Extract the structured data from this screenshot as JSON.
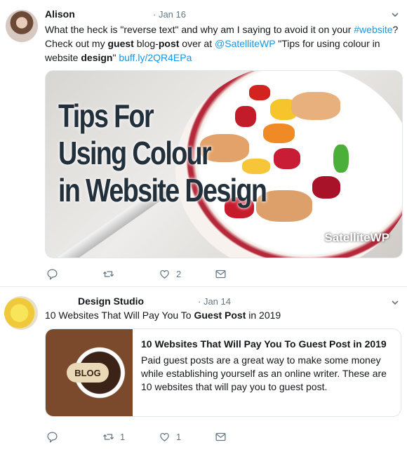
{
  "tweets": [
    {
      "author": "Alison",
      "date": "· Jan 16",
      "text_parts": {
        "p1": "What the heck is \"reverse text\" and why am I saying to avoid it on your ",
        "hashtag": "#website",
        "p2": "? Check out my ",
        "b1": "guest",
        "p3": " blog-",
        "b2": "post",
        "p4": " over at ",
        "mention": "@SatelliteWP",
        "p5": " \"Tips for using colour in website ",
        "b3": "design",
        "p6": "\" ",
        "link": "buff.ly/2QR4EPa"
      },
      "media": {
        "headline_line1": "Tips For",
        "headline_line2": "Using Colour",
        "headline_line3": "in Website Design",
        "brand": "SatelliteWP"
      },
      "actions": {
        "reply_count": "",
        "retweet_count": "",
        "like_count": "2"
      }
    },
    {
      "author": "Design Studio",
      "date": "· Jan 14",
      "text_parts": {
        "p1": "10 Websites That Will Pay You To ",
        "b1": "Guest Post",
        "p2": " in 2019"
      },
      "card": {
        "badge": "BLOG",
        "title": "10 Websites That Will Pay You To Guest Post in 2019",
        "description": "Paid guest posts are a great way to make some money while establishing yourself as an online writer. These are 10 websites that will pay you to guest post."
      },
      "actions": {
        "reply_count": "",
        "retweet_count": "1",
        "like_count": "1"
      }
    }
  ],
  "icons": {
    "reply": "reply-icon",
    "retweet": "retweet-icon",
    "like": "heart-icon",
    "message": "envelope-icon",
    "menu": "chevron-down-icon"
  },
  "colors": {
    "link": "#1b95e0",
    "muted": "#657786",
    "divider": "#e6ecf0"
  }
}
